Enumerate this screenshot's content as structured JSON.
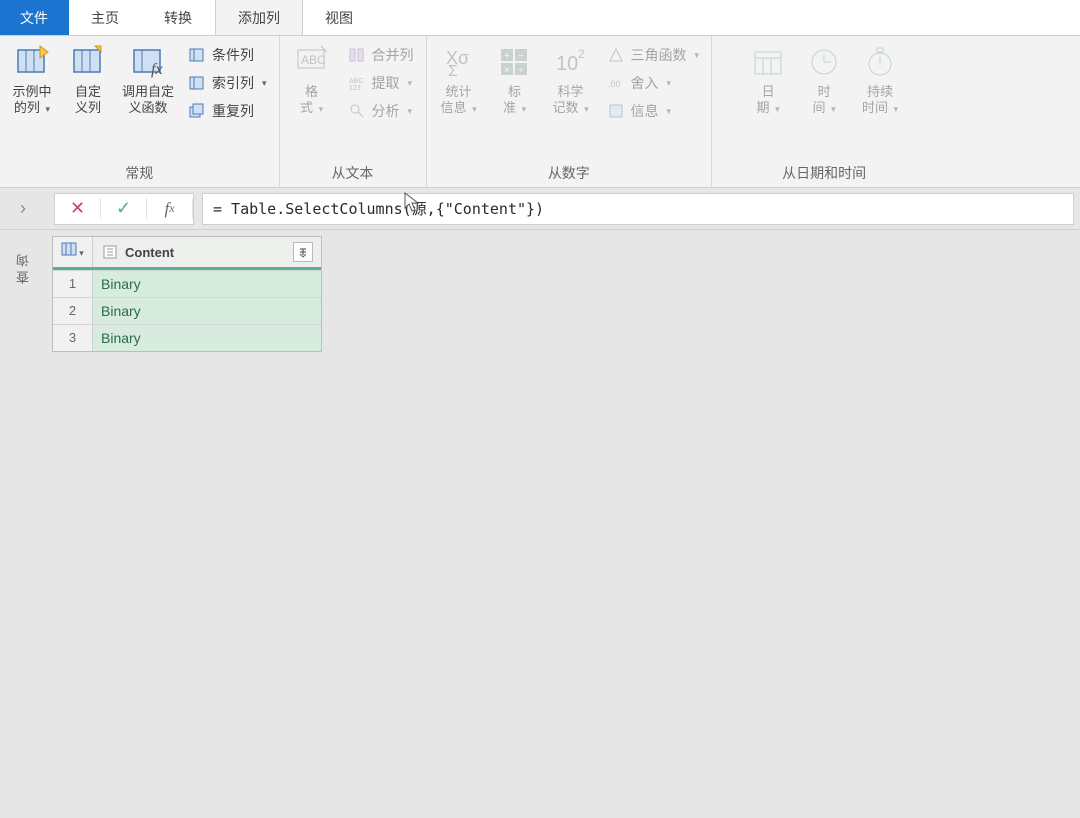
{
  "tabs": {
    "file": "文件",
    "home": "主页",
    "transform": "转换",
    "addcolumn": "添加列",
    "view": "视图"
  },
  "ribbon": {
    "group_general": {
      "label": "常规",
      "example_col": "示例中\n的列",
      "custom_col": "自定\n义列",
      "invoke_fn": "调用自定\n义函数",
      "cond_col": "条件列",
      "index_col": "索引列",
      "dup_col": "重复列"
    },
    "group_text": {
      "label": "从文本",
      "format": "格\n式",
      "merge": "合并列",
      "extract": "提取",
      "parse": "分析"
    },
    "group_number": {
      "label": "从数字",
      "stats": "统计\n信息",
      "standard": "标\n准",
      "scientific": "科学\n记数",
      "trig": "三角函数",
      "round": "舍入",
      "info": "信息"
    },
    "group_datetime": {
      "label": "从日期和时间",
      "date": "日\n期",
      "time": "时\n间",
      "duration": "持续\n时间"
    }
  },
  "formula": {
    "value": "= Table.SelectColumns(源,{\"Content\"})"
  },
  "sidebar": {
    "label": "查询"
  },
  "table": {
    "header": "Content",
    "rows": [
      "Binary",
      "Binary",
      "Binary"
    ]
  }
}
